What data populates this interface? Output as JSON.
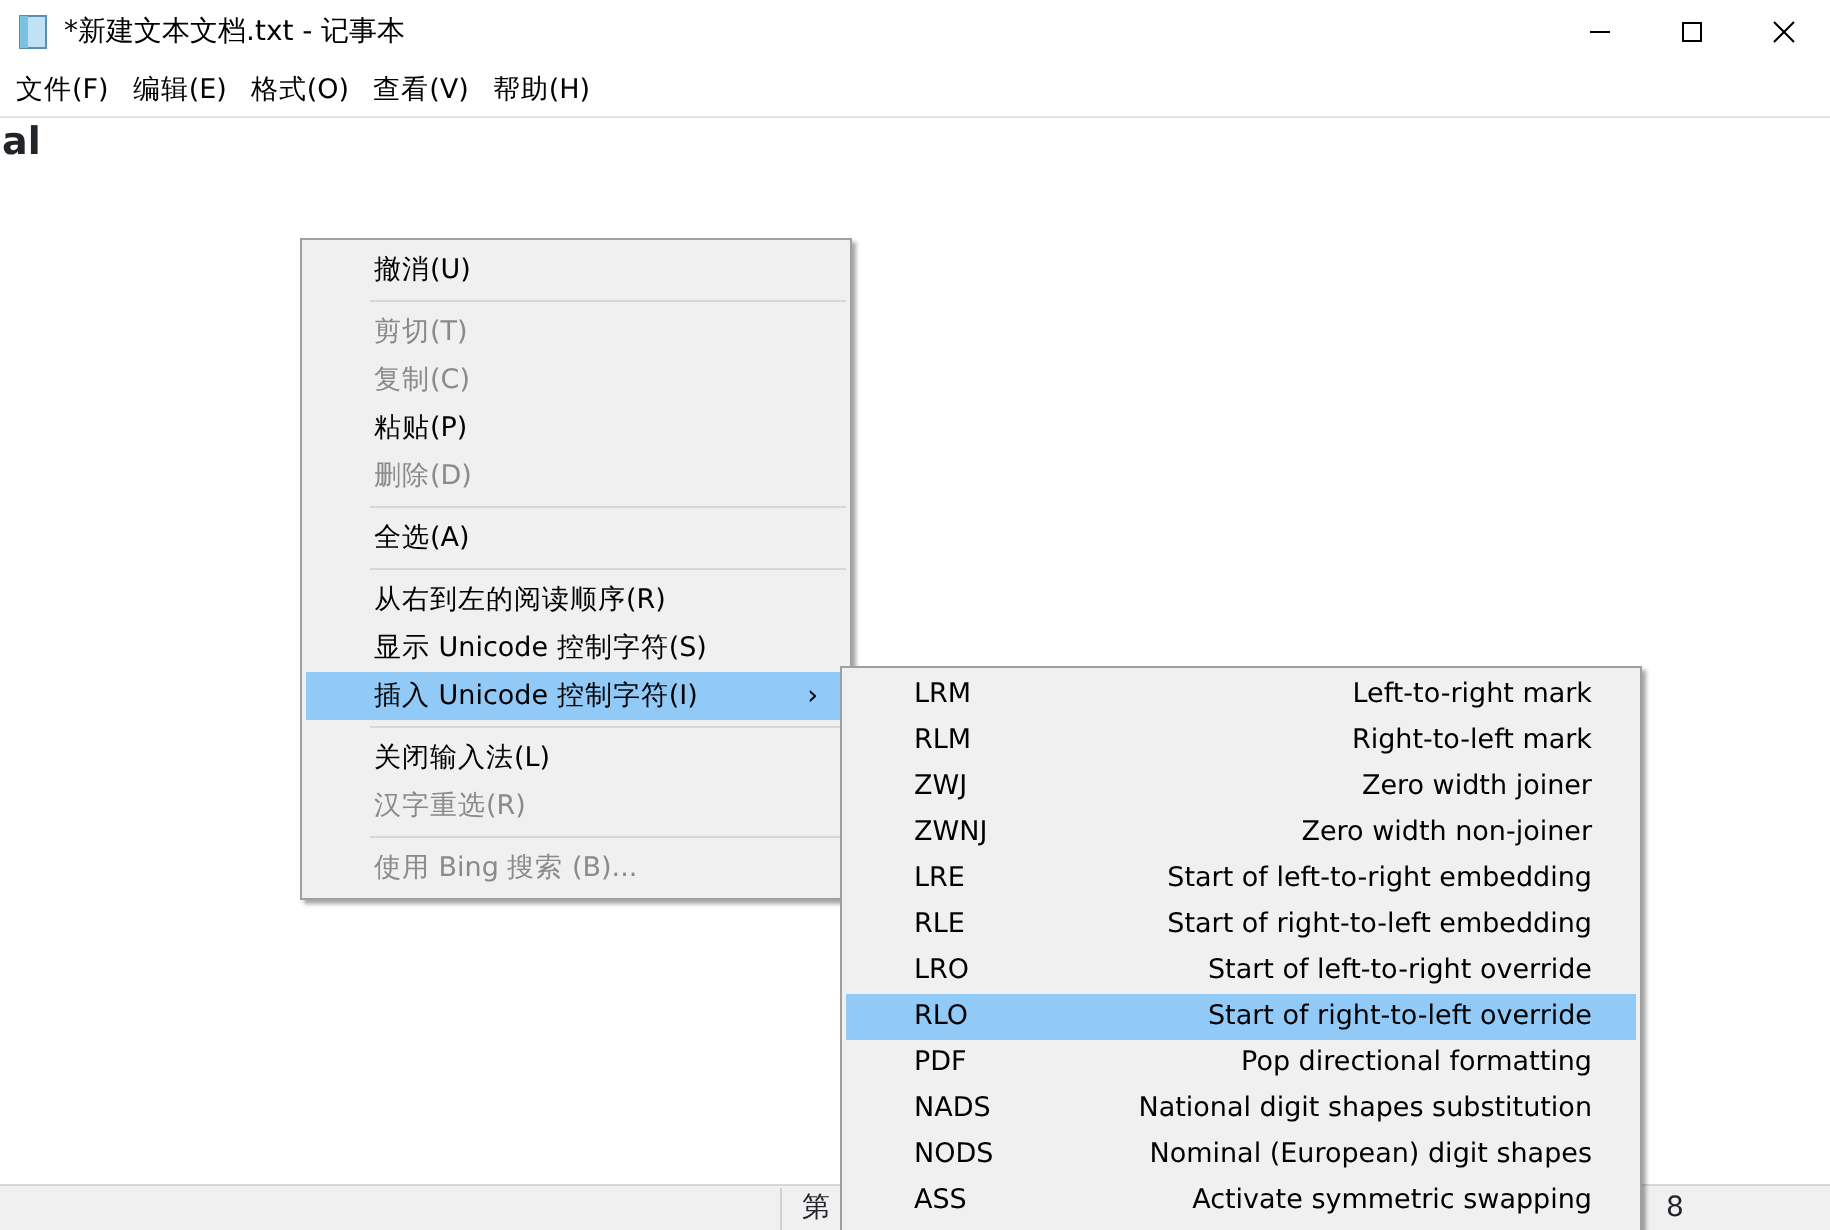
{
  "window": {
    "title": "*新建文本文档.txt - 记事本"
  },
  "menu_bar": [
    "文件(F)",
    "编辑(E)",
    "格式(O)",
    "查看(V)",
    "帮助(H)"
  ],
  "editor": {
    "text": "al"
  },
  "context_menu": [
    {
      "kind": "item",
      "label": "撤消(U)",
      "disabled": false,
      "selected": false
    },
    {
      "kind": "separator"
    },
    {
      "kind": "item",
      "label": "剪切(T)",
      "disabled": true,
      "selected": false
    },
    {
      "kind": "item",
      "label": "复制(C)",
      "disabled": true,
      "selected": false
    },
    {
      "kind": "item",
      "label": "粘贴(P)",
      "disabled": false,
      "selected": false
    },
    {
      "kind": "item",
      "label": "删除(D)",
      "disabled": true,
      "selected": false
    },
    {
      "kind": "separator"
    },
    {
      "kind": "item",
      "label": "全选(A)",
      "disabled": false,
      "selected": false
    },
    {
      "kind": "separator"
    },
    {
      "kind": "item",
      "label": "从右到左的阅读顺序(R)",
      "disabled": false,
      "selected": false
    },
    {
      "kind": "item",
      "label": "显示 Unicode 控制字符(S)",
      "disabled": false,
      "selected": false
    },
    {
      "kind": "submenu",
      "label": "插入 Unicode 控制字符(I)",
      "arrow": "›",
      "disabled": false,
      "selected": true
    },
    {
      "kind": "separator"
    },
    {
      "kind": "item",
      "label": "关闭输入法(L)",
      "disabled": false,
      "selected": false
    },
    {
      "kind": "item",
      "label": "汉字重选(R)",
      "disabled": true,
      "selected": false
    },
    {
      "kind": "separator"
    },
    {
      "kind": "item",
      "label": "使用 Bing 搜索 (B)...",
      "disabled": true,
      "selected": false
    }
  ],
  "submenu": [
    {
      "code": "LRM",
      "label": "Left-to-right mark",
      "selected": false
    },
    {
      "code": "RLM",
      "label": "Right-to-left mark",
      "selected": false
    },
    {
      "code": "ZWJ",
      "label": "Zero width joiner",
      "selected": false
    },
    {
      "code": "ZWNJ",
      "label": "Zero width non-joiner",
      "selected": false
    },
    {
      "code": "LRE",
      "label": "Start of left-to-right embedding",
      "selected": false
    },
    {
      "code": "RLE",
      "label": "Start of right-to-left embedding",
      "selected": false
    },
    {
      "code": "LRO",
      "label": "Start of left-to-right override",
      "selected": false
    },
    {
      "code": "RLO",
      "label": "Start of right-to-left override",
      "selected": true
    },
    {
      "code": "PDF",
      "label": "Pop directional formatting",
      "selected": false
    },
    {
      "code": "NADS",
      "label": "National digit shapes substitution",
      "selected": false
    },
    {
      "code": "NODS",
      "label": "Nominal (European) digit shapes",
      "selected": false
    },
    {
      "code": "ASS",
      "label": "Activate symmetric swapping",
      "selected": false
    }
  ],
  "status_bar": [
    "第",
    "8"
  ]
}
